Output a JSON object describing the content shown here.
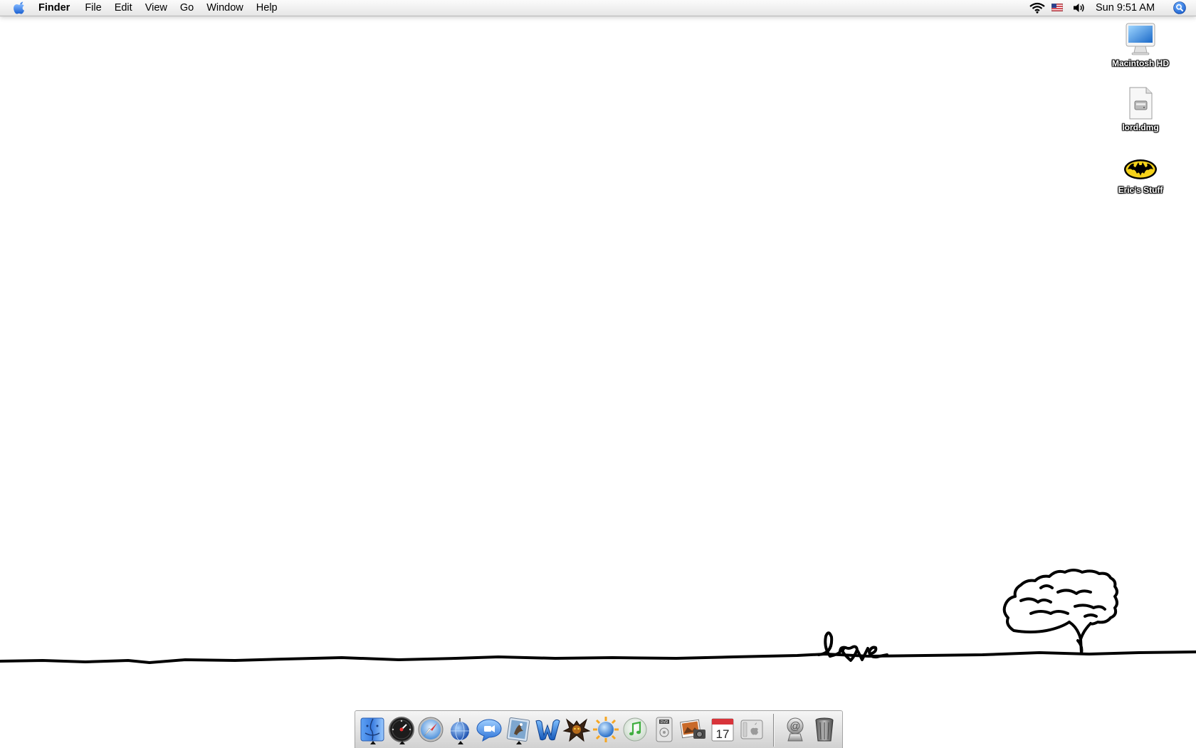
{
  "menubar": {
    "app_name": "Finder",
    "menus": [
      "File",
      "Edit",
      "View",
      "Go",
      "Window",
      "Help"
    ],
    "clock": "Sun 9:51 AM",
    "icons": [
      "apple-logo-icon",
      "wifi-icon",
      "us-flag-input-menu-icon",
      "volume-icon",
      "spotlight-icon"
    ]
  },
  "desktop": {
    "icons": [
      {
        "label": "Macintosh HD",
        "icon": "imac-hard-drive-icon"
      },
      {
        "label": "lord.dmg",
        "icon": "disk-image-icon"
      },
      {
        "label": "Eric's Stuff",
        "icon": "batman-folder-icon"
      }
    ],
    "wallpaper_text": "love"
  },
  "dock": {
    "apps": [
      {
        "icon": "finder-icon",
        "running": true
      },
      {
        "icon": "dashboard-icon",
        "running": true
      },
      {
        "icon": "safari-icon",
        "running": false
      },
      {
        "icon": "network-globe-icon",
        "running": true
      },
      {
        "icon": "ichat-icon",
        "running": false
      },
      {
        "icon": "preview-eagle-icon",
        "running": true
      },
      {
        "icon": "word-icon",
        "running": false
      },
      {
        "icon": "game-creature-icon",
        "running": false
      },
      {
        "icon": "sun-globe-icon",
        "running": false
      },
      {
        "icon": "itunes-icon",
        "running": false
      },
      {
        "icon": "dvd-player-icon",
        "running": false
      },
      {
        "icon": "iphoto-icon",
        "running": false
      },
      {
        "icon": "ical-icon",
        "running": false
      },
      {
        "icon": "system-preferences-icon",
        "running": false
      }
    ],
    "ical_date": "17",
    "others": [
      {
        "icon": "mail-at-icon"
      },
      {
        "icon": "trash-icon"
      }
    ]
  }
}
